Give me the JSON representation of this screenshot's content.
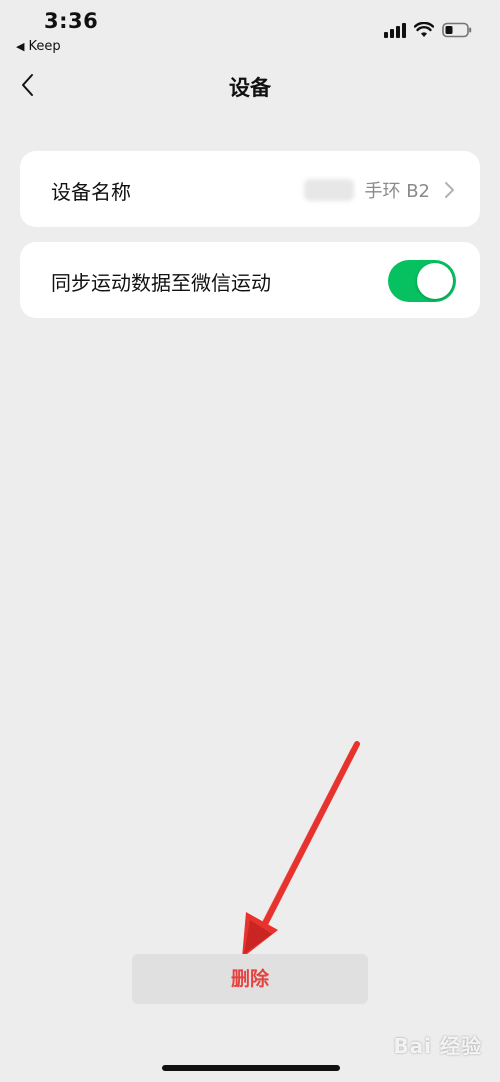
{
  "status_bar": {
    "time": "3:36",
    "back_app_label": "Keep"
  },
  "nav": {
    "title": "设备"
  },
  "settings": {
    "device_name": {
      "label": "设备名称",
      "value": "手环 B2"
    },
    "sync_sport": {
      "label": "同步运动数据至微信运动",
      "enabled": true
    }
  },
  "actions": {
    "delete_label": "删除"
  },
  "watermark": {
    "text": "Bai 经验"
  },
  "colors": {
    "background": "#ededed",
    "card": "#ffffff",
    "toggle_on": "#07c160",
    "delete_text": "#e64340",
    "annotation_arrow": "#e8322e"
  },
  "icons": {
    "nav_back": "chevron-left-icon",
    "row_chevron": "chevron-right-icon",
    "cellular": "cellular-signal-icon",
    "wifi": "wifi-icon",
    "battery": "battery-icon"
  }
}
